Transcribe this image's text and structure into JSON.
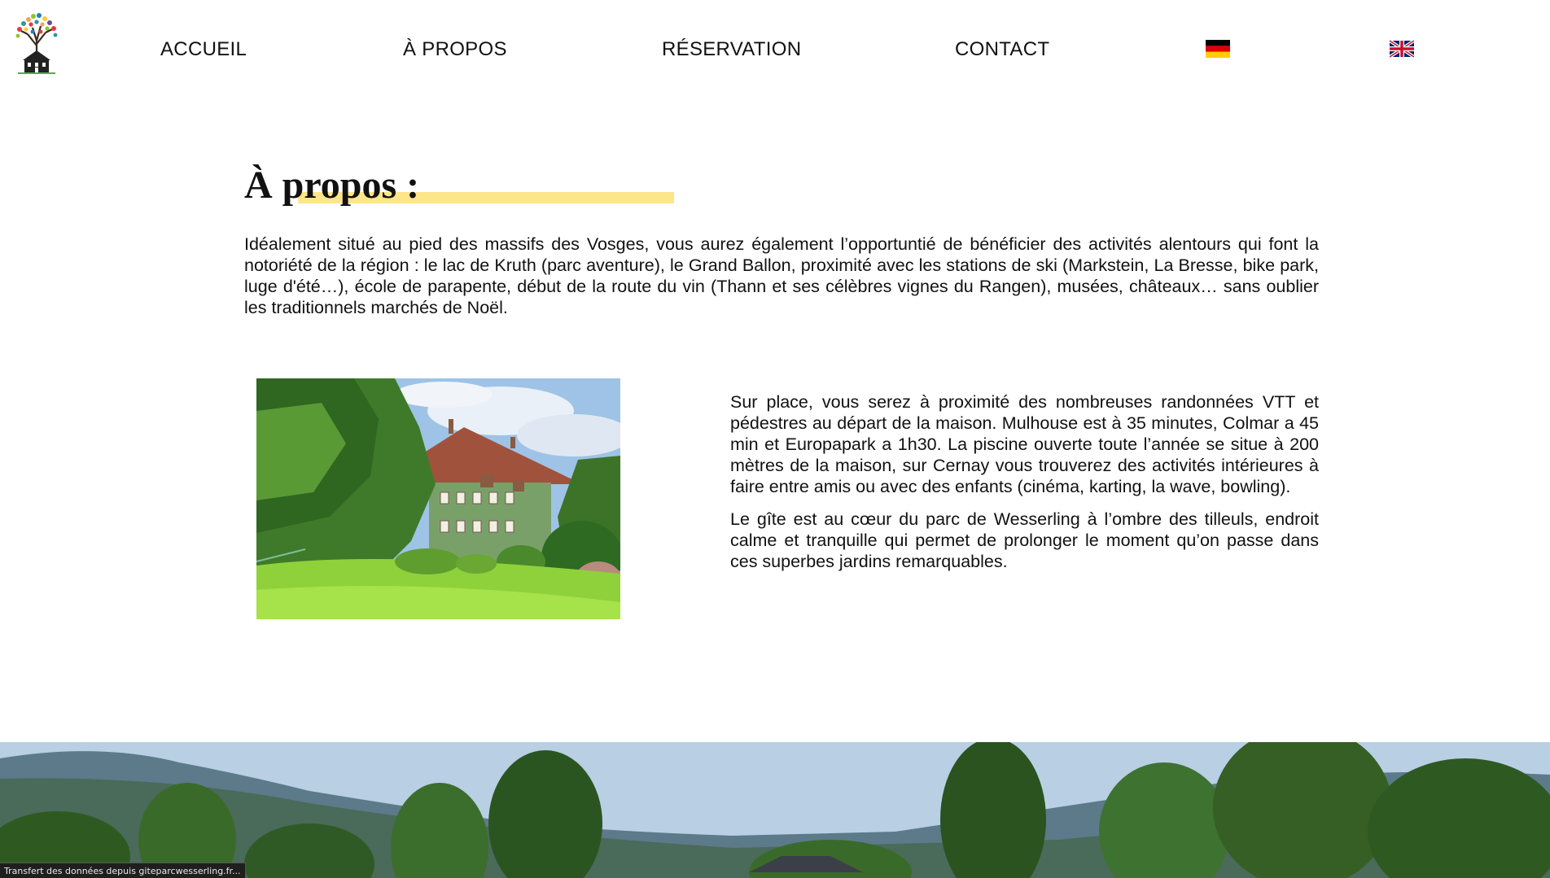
{
  "nav": {
    "items": [
      {
        "label": "ACCUEIL"
      },
      {
        "label": "À PROPOS"
      },
      {
        "label": "RÉSERVATION"
      },
      {
        "label": "CONTACT"
      }
    ],
    "flags": [
      {
        "icon": "german-flag-icon",
        "colors": [
          "#000000",
          "#dd0000",
          "#ffce00"
        ]
      },
      {
        "icon": "uk-flag-icon",
        "colors": [
          "#012169",
          "#ffffff",
          "#c8102e"
        ]
      }
    ]
  },
  "about": {
    "title": "À propos :",
    "highlight_color": "#fde58a",
    "intro": "Idéalement situé au pied des massifs des Vosges, vous aurez également l’opportuntié de bénéficier des activités alentours qui font la notoriété de la région : le lac de Kruth (parc aventure), le Grand Ballon, proximité avec les stations de ski (Markstein, La Bresse, bike park, luge d'été…), école de parapente, début de la route du vin (Thann et ses célèbres vignes du Rangen), musées, châteaux… sans oublier les traditionnels marchés de Noël.",
    "side_paragraphs": [
      "Sur place, vous serez à proximité des nombreuses randonnées VTT et pédestres au départ de la maison. Mulhouse est à 35 minutes, Colmar a 45 min et Europapark a 1h30. La piscine ouverte toute l’année se situe à 200 mètres de la maison, sur Cernay vous trouverez des activités intérieures à faire entre amis ou avec des enfants (cinéma, karting, la wave, bowling).",
      "Le gîte est au cœur du parc de Wesserling à l’ombre des tilleuls, endroit calme et tranquille qui permet de prolonger le moment qu’on passe dans ces superbes jardins remarquables."
    ]
  },
  "status": {
    "text": "Transfert des données depuis giteparcwesserling.fr..."
  }
}
